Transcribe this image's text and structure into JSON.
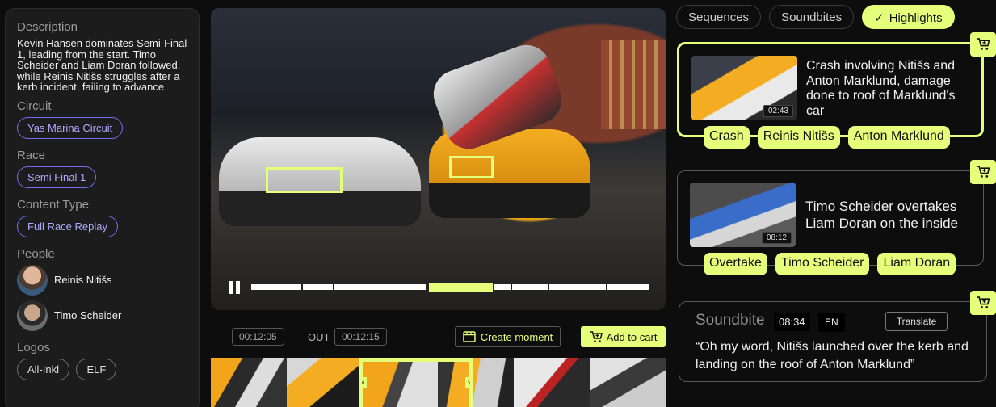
{
  "sidebar": {
    "description_heading": "Description",
    "description": "Kevin Hansen dominates Semi-Final 1, leading from the start. Timo Scheider and Liam Doran followed, while Reinis Nitišs struggles after a kerb incident, failing to advance",
    "circuit_heading": "Circuit",
    "circuit": "Yas Marina Circuit",
    "race_heading": "Race",
    "race": "Semi Final 1",
    "content_type_heading": "Content Type",
    "content_type": "Full Race Replay",
    "people_heading": "People",
    "people": [
      {
        "name": "Reinis Nitišs"
      },
      {
        "name": "Timo Scheider"
      }
    ],
    "logos_heading": "Logos",
    "logos": [
      "All-Inkl",
      "ELF"
    ]
  },
  "player": {
    "segments": [
      {
        "start": 0.0,
        "end": 0.127
      },
      {
        "start": 0.131,
        "end": 0.205
      },
      {
        "start": 0.209,
        "end": 0.44
      },
      {
        "start": 0.447,
        "end": 0.608,
        "highlight": true
      },
      {
        "start": 0.612,
        "end": 0.652
      },
      {
        "start": 0.656,
        "end": 0.745
      },
      {
        "start": 0.749,
        "end": 0.893
      },
      {
        "start": 0.897,
        "end": 1.0
      }
    ],
    "in_time": "00:12:05",
    "out_label": "OUT",
    "out_time": "00:12:15",
    "create_moment_label": "Create moment",
    "add_to_cart_label": "Add to cart"
  },
  "tabs": {
    "sequences": "Sequences",
    "soundbites": "Soundbites",
    "highlights": "Highlights",
    "active": "highlights"
  },
  "highlights": [
    {
      "title": "Crash involving Nitišs and Anton Marklund, damage done to roof of Marklund's car",
      "time": "02:43",
      "tags": [
        "Crash",
        "Reinis Nitišs",
        "Anton Marklund"
      ]
    },
    {
      "title": "Timo Scheider overtakes Liam Doran on the inside",
      "time": "08:12",
      "tags": [
        "Overtake",
        "Timo Scheider",
        "Liam Doran"
      ]
    }
  ],
  "soundbite": {
    "label": "Soundbite",
    "time": "08:34",
    "lang": "EN",
    "translate_label": "Translate",
    "quote": "“Oh my word, Nitišs launched over the kerb and landing on the roof of Anton Marklund”"
  },
  "colors": {
    "accent": "#e6ff7a",
    "chip_border": "#7a6cf0"
  }
}
